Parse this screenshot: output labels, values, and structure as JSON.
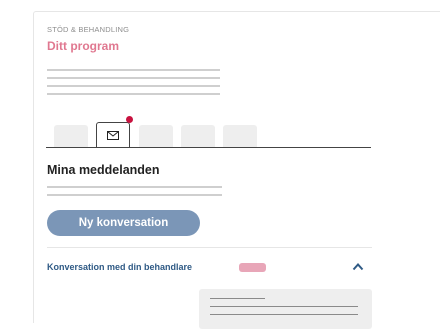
{
  "header": {
    "kicker": "STÖD & BEHANDLING",
    "title": "Ditt program"
  },
  "tabs": {
    "active_icon": "mail-icon",
    "count": 5,
    "notification": true
  },
  "messages": {
    "title": "Mina meddelanden",
    "new_button": "Ny konversation"
  },
  "conversation": {
    "label": "Konversation med din behandlare",
    "expanded": true,
    "chevron_icon": "chevron-up-icon"
  },
  "colors": {
    "accent_pink": "#e07890",
    "button_blue": "#7b96b7",
    "link_blue": "#2f5a85",
    "notification_red": "#c8123f"
  }
}
